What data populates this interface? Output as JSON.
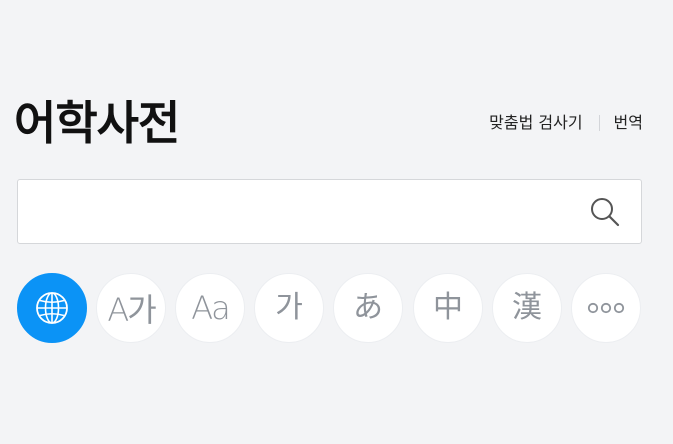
{
  "header": {
    "title": "어학사전",
    "links": [
      {
        "label": "맞춤법 검사기"
      },
      {
        "label": "번역"
      }
    ]
  },
  "search": {
    "value": "",
    "placeholder": "",
    "icon": "search-icon"
  },
  "language_buttons": [
    {
      "id": "all",
      "icon": "globe-icon",
      "label": "",
      "selected": true
    },
    {
      "id": "english-korean",
      "icon": "a-ga-icon",
      "label": "A가",
      "selected": false
    },
    {
      "id": "english",
      "icon": "aa-icon",
      "label": "Aa",
      "selected": false
    },
    {
      "id": "korean",
      "icon": "ga-icon",
      "label": "가",
      "selected": false
    },
    {
      "id": "japanese",
      "icon": "hiragana-a-icon",
      "label": "あ",
      "selected": false
    },
    {
      "id": "chinese",
      "icon": "zhong-icon",
      "label": "中",
      "selected": false
    },
    {
      "id": "hanja",
      "icon": "han-icon",
      "label": "漢",
      "selected": false
    },
    {
      "id": "more",
      "icon": "more-icon",
      "label": "",
      "selected": false
    }
  ],
  "colors": {
    "background": "#f3f4f6",
    "accent": "#0b93f6",
    "icon_gray": "#8f949b",
    "text": "#111111"
  }
}
